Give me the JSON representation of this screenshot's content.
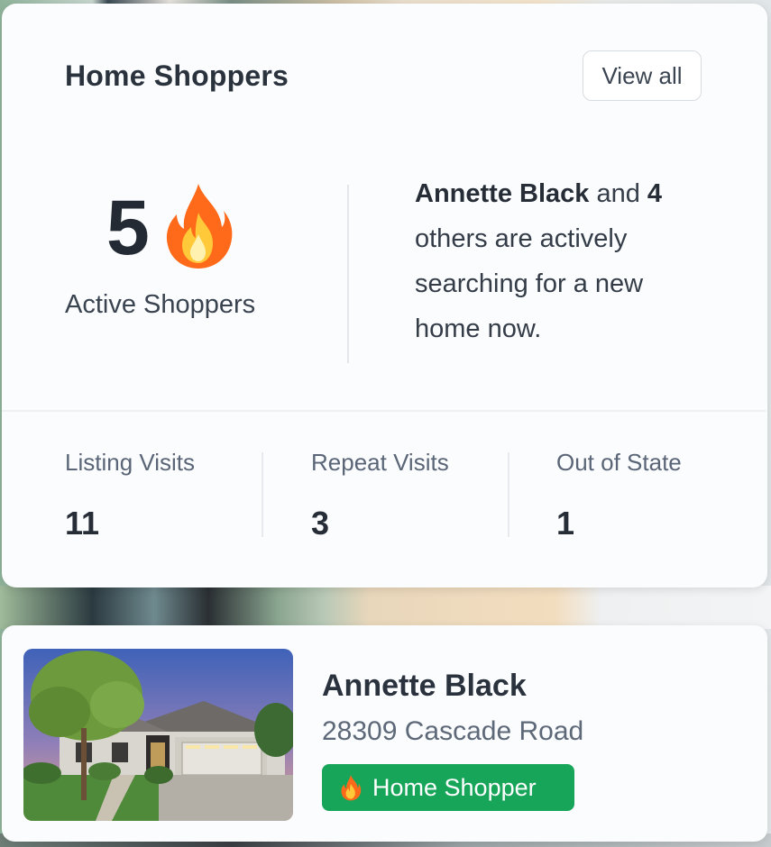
{
  "card": {
    "title": "Home Shoppers",
    "view_all_label": "View all",
    "active_count": "5",
    "active_label": "Active Shoppers",
    "summary": {
      "name": "Annette Black",
      "connector": " and ",
      "others_count": "4",
      "rest": " others are actively searching for a new home now."
    },
    "stats": [
      {
        "label": "Listing Visits",
        "value": "11"
      },
      {
        "label": "Repeat Visits",
        "value": "3"
      },
      {
        "label": "Out of State",
        "value": "1"
      }
    ]
  },
  "shopper": {
    "name": "Annette Black",
    "address": "28309 Cascade Road",
    "badge_label": "Home Shopper"
  },
  "icons": {
    "active": "fire-icon",
    "badge": "fire-icon"
  },
  "colors": {
    "badge_bg": "#17a559",
    "fire_outer": "#ff6a1a",
    "fire_inner": "#ffc93a"
  }
}
